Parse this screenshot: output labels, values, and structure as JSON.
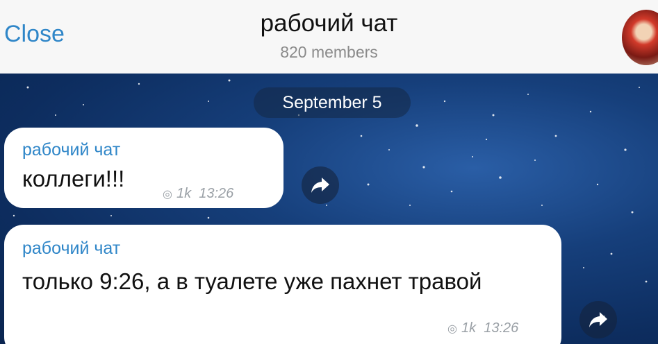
{
  "header": {
    "close_label": "Close",
    "title": "рабочий чат",
    "members": "820 members"
  },
  "chat": {
    "date": "September 5",
    "messages": [
      {
        "sender": "рабочий чат",
        "text": "коллеги!!!",
        "views": "1k",
        "time": "13:26"
      },
      {
        "sender": "рабочий чат",
        "text": "только 9:26, а в туалете уже пахнет травой",
        "views": "1k",
        "time": "13:26"
      }
    ]
  },
  "colors": {
    "accent": "#2f86c8",
    "chat_background": "#163f7b",
    "bubble": "#ffffff",
    "header": "#f7f7f7"
  },
  "icons": [
    "eye-icon",
    "forward-icon",
    "avatar"
  ]
}
